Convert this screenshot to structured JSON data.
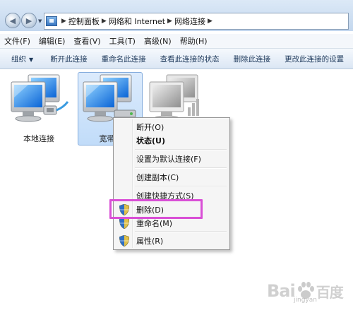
{
  "address": {
    "crumbs": [
      "控制面板",
      "网络和 Internet",
      "网络连接"
    ]
  },
  "menubar": {
    "items": [
      "文件(F)",
      "编辑(E)",
      "查看(V)",
      "工具(T)",
      "高级(N)",
      "帮助(H)"
    ]
  },
  "commandbar": {
    "organize": "组织",
    "items": [
      "断开此连接",
      "重命名此连接",
      "查看此连接的状态",
      "删除此连接",
      "更改此连接的设置"
    ]
  },
  "connections": [
    {
      "label": "本地连接"
    },
    {
      "label": "宽带连"
    },
    {
      "label": ""
    }
  ],
  "context_menu": {
    "items": [
      "断开(O)",
      "状态(U)",
      "设置为默认连接(F)",
      "创建副本(C)",
      "创建快捷方式(S)",
      "删除(D)",
      "重命名(M)",
      "属性(R)"
    ]
  },
  "watermark": {
    "text": "Bai",
    "sub": "jingyan"
  },
  "colors": {
    "highlight": "#d94fd6",
    "selection": "#c1dcf9"
  }
}
